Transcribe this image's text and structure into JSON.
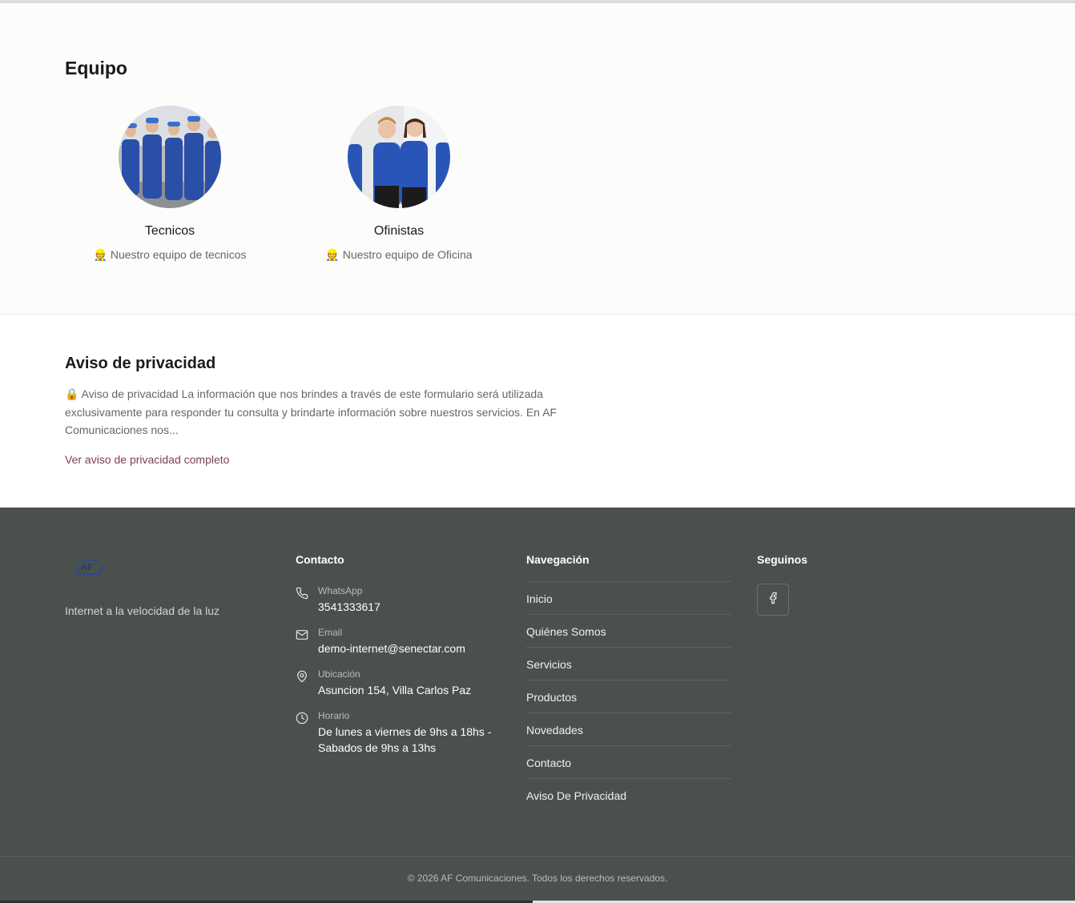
{
  "team": {
    "title": "Equipo",
    "members": [
      {
        "name": "Tecnicos",
        "emoji": "👷",
        "desc": "Nuestro equipo de tecnicos"
      },
      {
        "name": "Ofinistas",
        "emoji": "👷",
        "desc": "Nuestro equipo de Oficina"
      }
    ]
  },
  "privacy": {
    "title": "Aviso de privacidad",
    "text": "🔒 Aviso de privacidad La información que nos brindes a través de este formulario será utilizada exclusivamente para responder tu consulta y brindarte información sobre nuestros servicios. En AF Comunicaciones nos...",
    "link": "Ver aviso de privacidad completo"
  },
  "footer": {
    "tagline": "Internet a la velocidad de la luz",
    "contact_title": "Contacto",
    "contact": [
      {
        "label": "WhatsApp",
        "value": "3541333617",
        "icon": "phone-icon"
      },
      {
        "label": "Email",
        "value": "demo-internet@senectar.com",
        "icon": "mail-icon"
      },
      {
        "label": "Ubicación",
        "value": "Asuncion 154, Villa Carlos Paz",
        "icon": "location-pin-icon"
      },
      {
        "label": "Horario",
        "value": "De lunes a viernes de 9hs a 18hs - Sabados de 9hs a 13hs",
        "icon": "clock-icon"
      }
    ],
    "nav_title": "Navegación",
    "nav": [
      "Inicio",
      "Quiénes Somos",
      "Servicios",
      "Productos",
      "Novedades",
      "Contacto",
      "Aviso De Privacidad"
    ],
    "social_title": "Seguinos",
    "social": [
      {
        "icon": "facebook-icon"
      }
    ],
    "copyright": "© 2026 AF Comunicaciones. Todos los derechos reservados."
  },
  "colors": {
    "footer_bg": "#4c504d",
    "link": "#7b3f5c",
    "uniform_blue": "#2a55b8"
  }
}
